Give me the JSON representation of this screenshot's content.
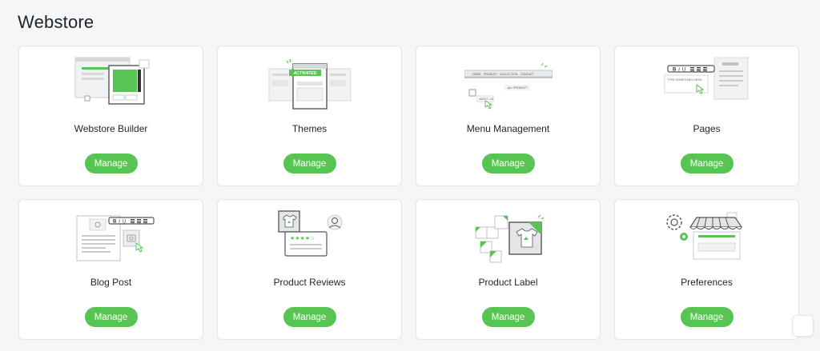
{
  "page": {
    "title": "Webstore"
  },
  "colors": {
    "accent": "#57c453",
    "card_border": "#e3e5e8",
    "background": "#f5f6f7"
  },
  "cards": [
    {
      "label": "Webstore Builder",
      "button": "Manage",
      "icon": "webstore-builder-icon"
    },
    {
      "label": "Themes",
      "button": "Manage",
      "icon": "themes-icon",
      "badge": "ACTIVATED"
    },
    {
      "label": "Menu Management",
      "button": "Manage",
      "icon": "menu-management-icon",
      "menu_items": [
        "HOME",
        "PRODUCT",
        "COLLECTION",
        "CONTACT"
      ],
      "add_product": "ALL PRODUCT",
      "about_us": "ABOUT US"
    },
    {
      "label": "Pages",
      "button": "Manage",
      "icon": "pages-icon",
      "editor_placeholder": "TYPE SOMETHING HERE..."
    },
    {
      "label": "Blog Post",
      "button": "Manage",
      "icon": "blog-post-icon"
    },
    {
      "label": "Product Reviews",
      "button": "Manage",
      "icon": "product-reviews-icon"
    },
    {
      "label": "Product Label",
      "button": "Manage",
      "icon": "product-label-icon"
    },
    {
      "label": "Preferences",
      "button": "Manage",
      "icon": "preferences-icon"
    }
  ]
}
